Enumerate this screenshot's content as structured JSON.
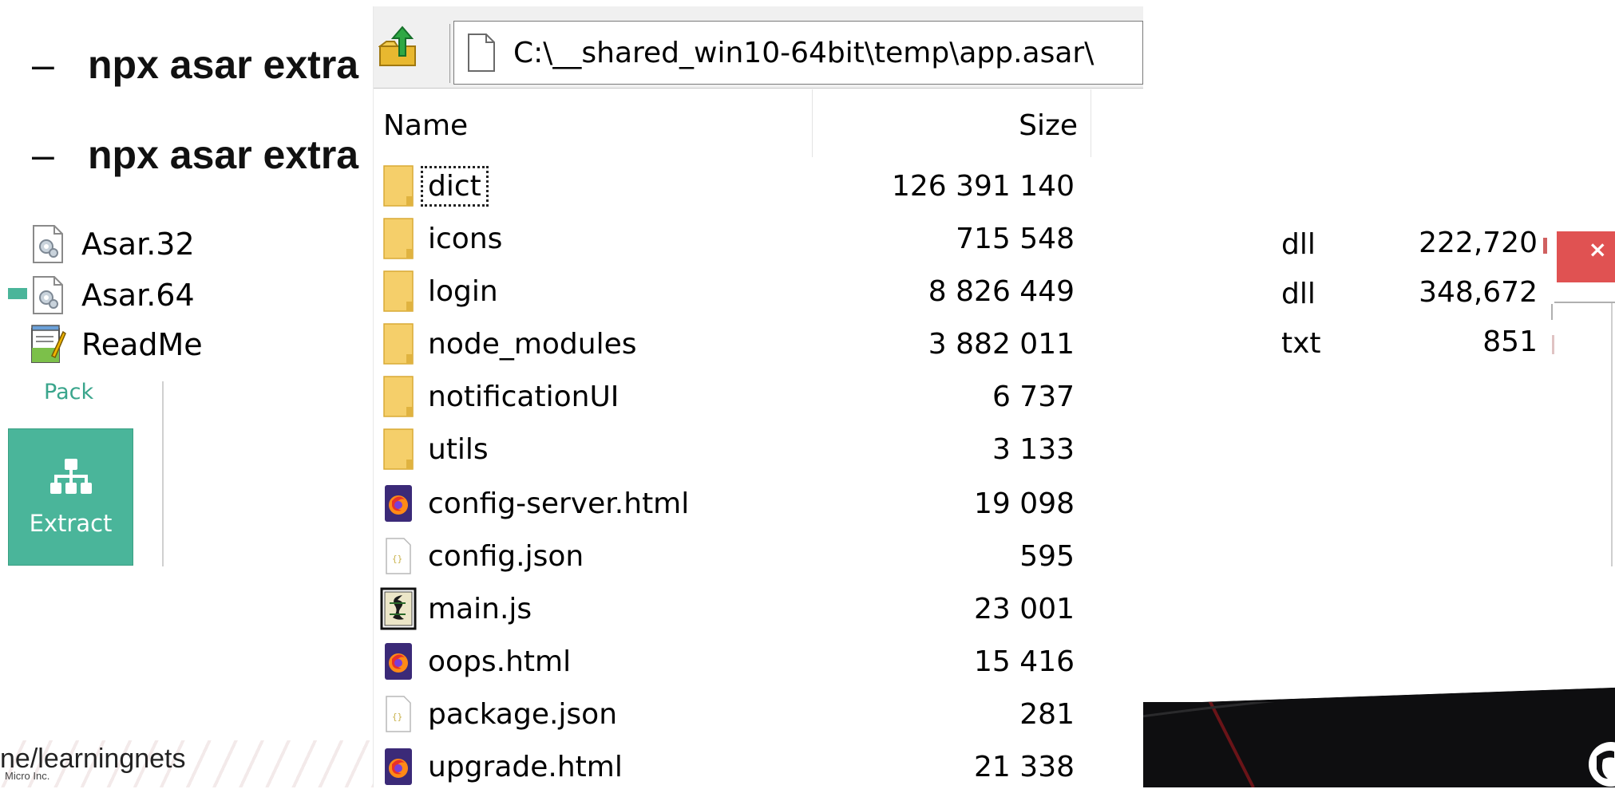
{
  "slide": {
    "bullets": [
      {
        "dash": "–",
        "text": "npx asar extra"
      },
      {
        "dash": "–",
        "text": "npx asar extra"
      }
    ],
    "footer_text": "ne/learningnets",
    "footer_copy": "Micro Inc."
  },
  "left_panel": {
    "files": [
      {
        "name": "Asar.32",
        "icon": "dll-gear-icon"
      },
      {
        "name": "Asar.64",
        "icon": "dll-gear-icon"
      },
      {
        "name": "ReadMe",
        "icon": "notepad-icon"
      }
    ],
    "pack_label": "Pack",
    "extract_label": "Extract"
  },
  "right_panel": {
    "rows": [
      {
        "type": "dll",
        "size": "222,720"
      },
      {
        "type": "dll",
        "size": "348,672"
      },
      {
        "type": "txt",
        "size": "851"
      }
    ],
    "close_glyph": "×"
  },
  "archive_window": {
    "path": "C:\\__shared_win10-64bit\\temp\\app.asar\\",
    "columns": {
      "name": "Name",
      "size": "Size"
    },
    "rows": [
      {
        "name": "dict",
        "size": "126 391 140",
        "icon": "folder-icon"
      },
      {
        "name": "icons",
        "size": "715 548",
        "icon": "folder-icon"
      },
      {
        "name": "login",
        "size": "8 826 449",
        "icon": "folder-icon"
      },
      {
        "name": "node_modules",
        "size": "3 882 011",
        "icon": "folder-icon"
      },
      {
        "name": "notificationUI",
        "size": "6 737",
        "icon": "folder-icon"
      },
      {
        "name": "utils",
        "size": "3 133",
        "icon": "folder-icon"
      },
      {
        "name": "config-server.html",
        "size": "19 098",
        "icon": "firefox-html-icon"
      },
      {
        "name": "config.json",
        "size": "595",
        "icon": "json-file-icon"
      },
      {
        "name": "main.js",
        "size": "23 001",
        "icon": "js-script-icon"
      },
      {
        "name": "oops.html",
        "size": "15 416",
        "icon": "firefox-html-icon"
      },
      {
        "name": "package.json",
        "size": "281",
        "icon": "json-file-icon"
      },
      {
        "name": "upgrade.html",
        "size": "21 338",
        "icon": "firefox-html-icon"
      }
    ]
  }
}
